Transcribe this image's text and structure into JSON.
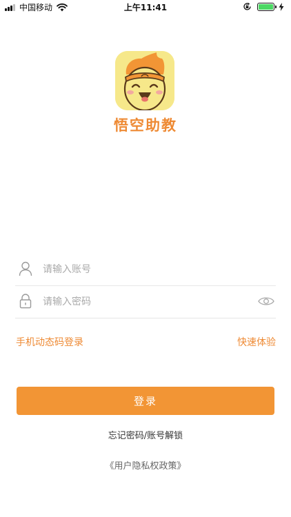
{
  "status_bar": {
    "carrier": "中国移动",
    "time": "上午11:41",
    "battery_level": 1.0,
    "signal_icon": "cellular-signal-icon",
    "wifi_icon": "wifi-icon",
    "rotation_lock_icon": "rotation-lock-icon",
    "battery_icon": "battery-icon",
    "charging_icon": "charging-bolt-icon"
  },
  "app": {
    "name": "悟空助教",
    "logo_icon": "monkey-king-face-logo",
    "brand_color": "#ee8a34",
    "logo_bg": "#f6e88a"
  },
  "form": {
    "account_placeholder": "请输入账号",
    "password_placeholder": "请输入密码",
    "account_icon": "user-icon",
    "password_icon": "lock-icon",
    "show_password_icon": "eye-icon"
  },
  "links": {
    "sms_login": "手机动态码登录",
    "quick_trial": "快速体验"
  },
  "login_button": {
    "label": "登录",
    "color": "#f29535"
  },
  "forgot": "忘记密码/账号解锁",
  "privacy": "《用户隐私权政策》"
}
